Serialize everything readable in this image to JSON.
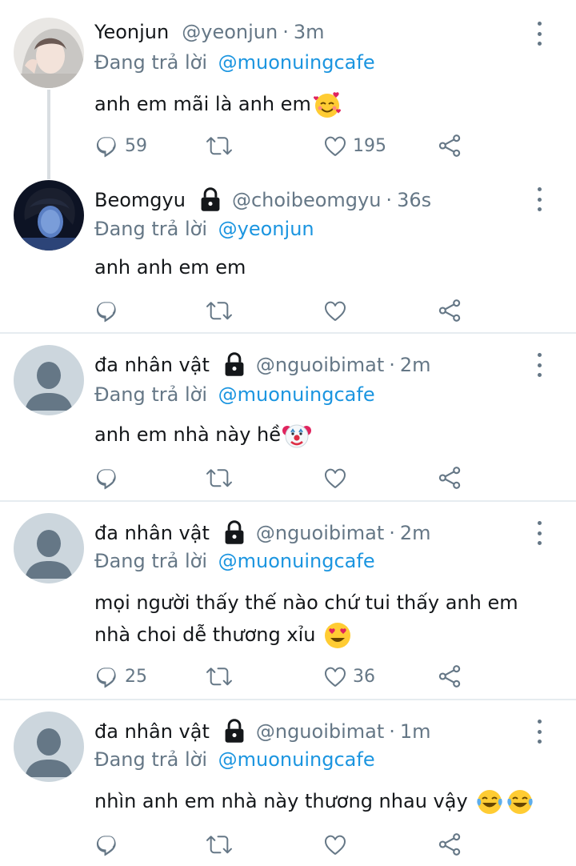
{
  "reply_prefix": "Đang trả lời",
  "tweets": [
    {
      "name": "Yeonjun",
      "handle": "@yeonjun",
      "separator": "·",
      "time": "3m",
      "reply_to": "@muonuingcafe",
      "text": "anh em mãi là anh em",
      "emoji": "smiling-face-with-hearts",
      "replies": "59",
      "retweets": "",
      "likes": "195",
      "protected": false
    },
    {
      "name": "Beomgyu",
      "handle": "@choibeomgyu",
      "separator": "·",
      "time": "36s",
      "reply_to": "@yeonjun",
      "text": "anh anh em em",
      "replies": "",
      "retweets": "",
      "likes": "",
      "protected": true
    },
    {
      "name": "đa nhân vật",
      "handle": "@nguoibimat",
      "separator": "·",
      "time": "2m",
      "reply_to": "@muonuingcafe",
      "text": "anh em nhà này hề",
      "emoji": "clown-face",
      "replies": "",
      "retweets": "",
      "likes": "",
      "protected": true
    },
    {
      "name": "đa nhân vật",
      "handle": "@nguoibimat",
      "separator": "·",
      "time": "2m",
      "reply_to": "@muonuingcafe",
      "text_line1": "mọi người thấy thế nào chứ tui thấy anh em",
      "text_line2": "nhà choi dễ thương xỉu",
      "emoji": "heart-eyes",
      "replies": "25",
      "retweets": "",
      "likes": "36",
      "protected": true
    },
    {
      "name": "đa nhân vật",
      "handle": "@nguoibimat",
      "separator": "·",
      "time": "1m",
      "reply_to": "@muonuingcafe",
      "text": "nhìn anh em nhà này thương nhau vậy",
      "emoji": "tears-of-joy",
      "replies": "",
      "retweets": "",
      "likes": "",
      "protected": true
    }
  ],
  "colors": {
    "link": "#1b95e0",
    "muted": "#657786",
    "divider": "#e6ecf0",
    "text": "#14171a"
  }
}
